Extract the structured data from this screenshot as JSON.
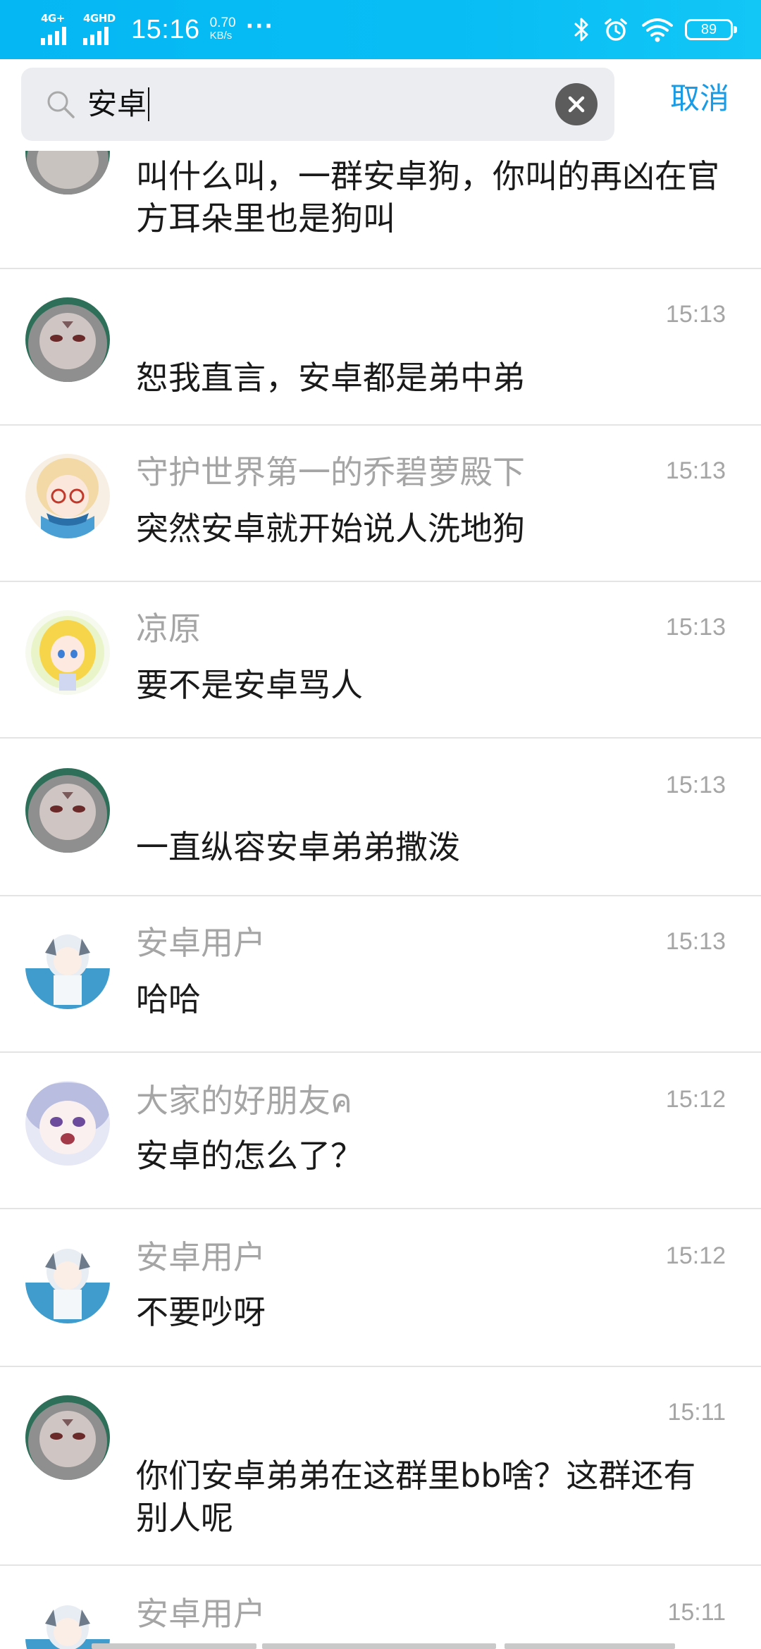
{
  "status_bar": {
    "signal1_label": "4G+",
    "signal2_label": "4GHD",
    "time": "15:16",
    "net_speed_value": "0.70",
    "net_speed_unit": "KB/s",
    "more": "···",
    "battery": "89",
    "icons": [
      "bluetooth-icon",
      "alarm-icon",
      "wifi-icon"
    ]
  },
  "search": {
    "icon": "search-icon",
    "query": "安卓",
    "clear_icon": "close-icon",
    "cancel_label": "取消"
  },
  "results": [
    {
      "sender": "",
      "time": "",
      "message": "叫什么叫，一群安卓狗，你叫的再凶在官方耳朵里也是狗叫",
      "avatar": "avatar-gray-cat"
    },
    {
      "sender": "",
      "time": "15:13",
      "message": "恕我直言，安卓都是弟中弟",
      "avatar": "avatar-gray-cat"
    },
    {
      "sender": "守护世界第一的乔碧萝殿下",
      "time": "15:13",
      "message": "突然安卓就开始说人洗地狗",
      "avatar": "avatar-blonde-glasses-girl"
    },
    {
      "sender": "凉原",
      "time": "15:13",
      "message": "要不是安卓骂人",
      "avatar": "avatar-blonde-chibi-girl"
    },
    {
      "sender": "",
      "time": "15:13",
      "message": "一直纵容安卓弟弟撒泼",
      "avatar": "avatar-gray-cat"
    },
    {
      "sender": "安卓用户",
      "time": "15:13",
      "message": "哈哈",
      "avatar": "avatar-white-hair-girl"
    },
    {
      "sender": "大家的好朋友ค",
      "time": "15:12",
      "message": "安卓的怎么了？",
      "avatar": "avatar-purple-hair-girl"
    },
    {
      "sender": "安卓用户",
      "time": "15:12",
      "message": "不要吵呀",
      "avatar": "avatar-white-hair-girl"
    },
    {
      "sender": "",
      "time": "15:11",
      "message": "你们安卓弟弟在这群里bb啥？这群还有别人呢",
      "avatar": "avatar-gray-cat"
    },
    {
      "sender": "安卓用户",
      "time": "15:11",
      "message": "",
      "avatar": "avatar-white-hair-girl"
    }
  ],
  "colors": {
    "status_bar": "#05b7f3",
    "accent": "#1a9be6",
    "sender_text": "#a5a5a5",
    "message_text": "#1a1a1a",
    "divider": "#e4e4e4",
    "search_box": "#ebedf0"
  }
}
